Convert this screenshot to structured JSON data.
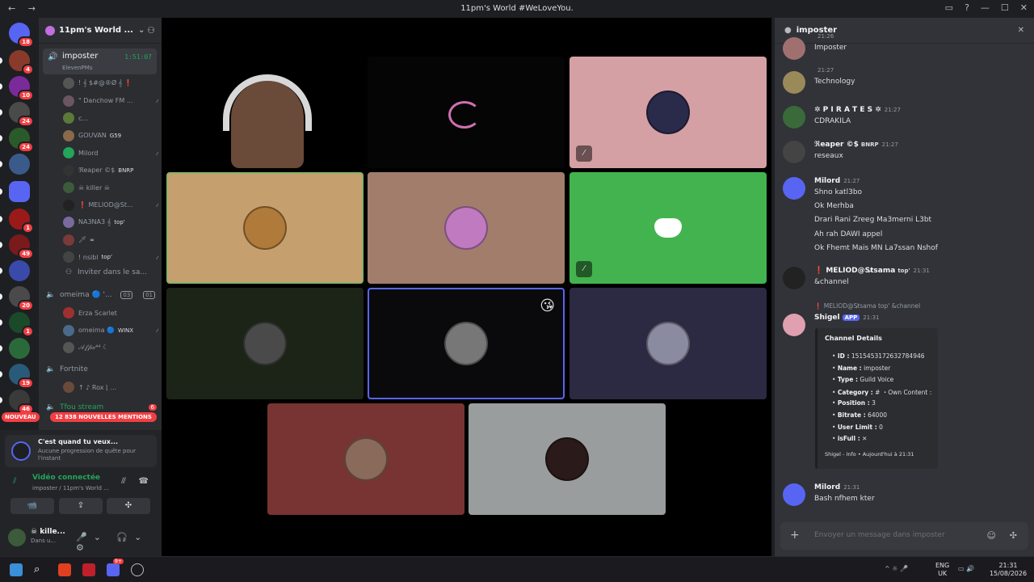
{
  "window": {
    "title": "11pm's World #WeLoveYou.",
    "nav": "← →",
    "controls": [
      "▭",
      "?",
      "—",
      "☐",
      "✕"
    ]
  },
  "servers": {
    "dm_badge": "18",
    "badges": [
      "4",
      "10",
      "24",
      "24",
      "1",
      "49",
      "20",
      "1",
      "19",
      "46"
    ]
  },
  "guild": {
    "name": "11pm's World ...",
    "chevron": "⌄",
    "add_people": "⚇"
  },
  "voice_channel": {
    "name": "imposter",
    "subtitle": "ElevenPMs",
    "timer": "1:51:07",
    "icon": "🔊"
  },
  "members": [
    {
      "name": "! 𝄞 $#@®Ø 𝄞 ❗",
      "tag": "",
      "color": "#555"
    },
    {
      "name": "\" Danchow FM ...",
      "tag": "",
      "color": "#6a5560"
    },
    {
      "name": "c...",
      "tag": "",
      "color": "#5b7a3a"
    },
    {
      "name": "GOUVAN",
      "tag": "G59",
      "color": "#8a6a4a"
    },
    {
      "name": "Milord",
      "tag": "",
      "color": "#23a55a"
    },
    {
      "name": "ℜeaper ©$",
      "tag": "BNRP",
      "color": "#333"
    },
    {
      "name": "☠ killer ☠",
      "tag": "",
      "color": "#3b5b3b"
    },
    {
      "name": "❗ MELIOD@St...",
      "tag": "",
      "color": "#222"
    },
    {
      "name": "NA3NA3 𝄞",
      "tag": "top'",
      "color": "#7a6aa0"
    },
    {
      "name": "🗡",
      "tag": "∞",
      "color": "#7a3a3a"
    },
    {
      "name": "! nsibl",
      "tag": "top'",
      "color": "#444"
    }
  ],
  "invite_label": "Inviter dans le sa...",
  "channel_omeima": {
    "name": "omeima 🔵 '...",
    "count_a": "03",
    "count_b": "01"
  },
  "omeima_members": [
    {
      "name": "Erza Scarlet",
      "tag": "",
      "color": "#a03030"
    },
    {
      "name": "omeima 🔵",
      "tag": "WINX",
      "color": "#4a6a8a"
    },
    {
      "name": "𝒜𝒻𝒻𝒾𝓍⁴⁴ ☾",
      "tag": "",
      "color": "#555"
    }
  ],
  "channel_fortnite": {
    "name": "Fortnite"
  },
  "fortnite_members": [
    {
      "name": "↑ ♪ Rox ⌊ ...",
      "tag": "",
      "color": "#6a4a3a"
    }
  ],
  "channel_partial": {
    "name": "Tfou stream",
    "badge": "6"
  },
  "new_bar": {
    "nouveau": "NOUVEAU",
    "mentions": "12 838 NOUVELLES MENTIONS"
  },
  "quest": {
    "title": "C'est quand tu veux...",
    "subtitle": "Aucune progression de quête pour l'instant"
  },
  "voice_conn": {
    "status": "Vidéo connectée",
    "location": "imposter / 11pm's World ..."
  },
  "actions": {
    "camera": "📹",
    "screen": "⇪",
    "activities": "✣"
  },
  "user": {
    "name": "☠ kille...",
    "status": "Dans u...",
    "controls": "🎤⌄ 🎧⌄ ⚙"
  },
  "tiles": [
    {
      "bg": "#000",
      "kind": "camera"
    },
    {
      "bg": "#050505",
      "kind": "art"
    },
    {
      "bg": "#d4a0a4",
      "kind": "avatar",
      "ava": "#2a2a4a",
      "muted": true
    },
    {
      "bg": "#c5a06e",
      "kind": "avatar",
      "ava": "#b07a3a",
      "border": "#8ab06a"
    },
    {
      "bg": "#a27d6c",
      "kind": "avatar",
      "ava": "#c07ac0"
    },
    {
      "bg": "#43b34f",
      "kind": "discord",
      "muted": true
    },
    {
      "bg": "#1c2418",
      "kind": "avatar",
      "ava": "#4a4a4a"
    },
    {
      "bg": "#0a0a0c",
      "kind": "avatar",
      "ava": "#777",
      "border": "#5865f2",
      "emoji": "😘"
    },
    {
      "bg": "#2c2a42",
      "kind": "avatar",
      "ava": "#8a8aa0"
    },
    {
      "bg": "#783433",
      "kind": "avatar",
      "ava": "#8a6a5a"
    },
    {
      "bg": "#9a9d9e",
      "kind": "avatar",
      "ava": "#2a1a1a"
    }
  ],
  "chat": {
    "title": "imposter",
    "messages": [
      {
        "author": "",
        "time": "21:26",
        "lines": [
          "Imposter"
        ]
      },
      {
        "author": "",
        "time": "21:27",
        "lines": [
          "Technology"
        ]
      },
      {
        "author": "✲ P I R A T E S ✲",
        "time": "21:27",
        "lines": [
          "CDRAKILA"
        ]
      },
      {
        "author": "ℜeaper ©$",
        "tag": "BNRP",
        "time": "21:27",
        "lines": [
          "reseaux"
        ]
      },
      {
        "author": "Milord",
        "time": "21:27",
        "lines": [
          "Shno katl3bo",
          "Ok Merhba",
          "Drari Rani Zreeg Ma3merni L3bt",
          "Ah rah DAWI appel",
          "Ok Fhemt Mais MN La7ssan Nshof"
        ]
      },
      {
        "author": "❗ MELIOD@St̷sama",
        "tag": "top'",
        "time": "21:31",
        "lines": [
          "&channel"
        ]
      },
      {
        "author": "Shigel",
        "tag": "APP",
        "time": "21:31",
        "lines": []
      },
      {
        "author": "Milord",
        "time": "21:31",
        "lines": [
          "Bash nfhem kter"
        ]
      }
    ],
    "reply": "❗ MELIOD@St̷sama  top'  &channel",
    "embed": {
      "title": "Channel Details",
      "rows": [
        {
          "k": "ID :",
          "v": "1515453172632784946"
        },
        {
          "k": "Name :",
          "v": "imposter"
        },
        {
          "k": "Type :",
          "v": "Guild Voice"
        },
        {
          "k": "Category :",
          "v": "# ・Own Content :"
        },
        {
          "k": "Position :",
          "v": "3"
        },
        {
          "k": "Bitrate :",
          "v": "64000"
        },
        {
          "k": "User Limit :",
          "v": "0"
        },
        {
          "k": "isFull :",
          "v": "✕"
        }
      ],
      "footer": "Shigel - Info • Aujourd'hui à 21:31"
    },
    "input_placeholder": "Envoyer un message dans imposter"
  },
  "taskbar": {
    "lang": "ENG",
    "region": "UK",
    "time": "21:31",
    "date": "15/08/2026",
    "discord_badge": "9+"
  }
}
